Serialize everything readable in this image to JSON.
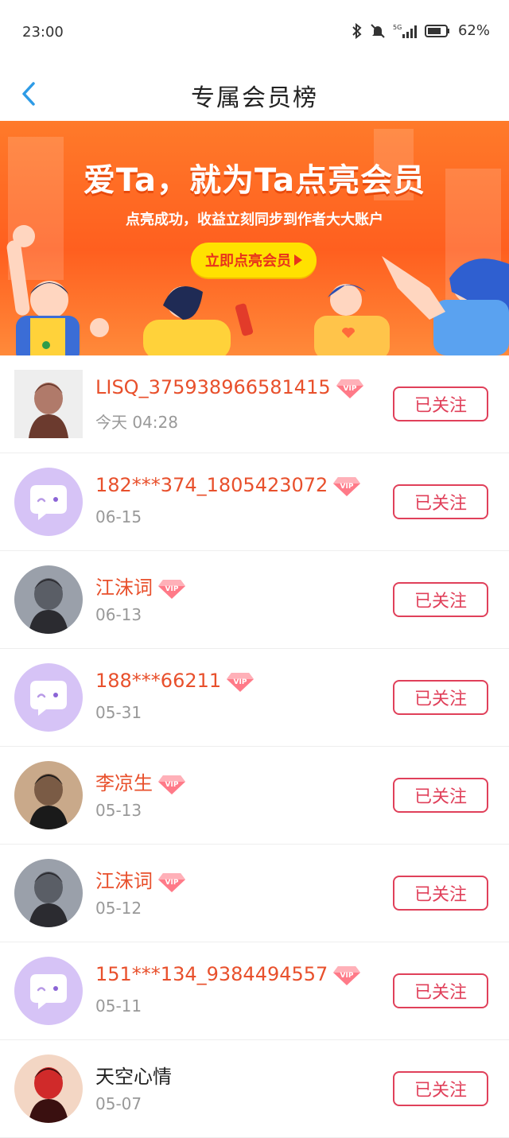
{
  "status_bar": {
    "time": "23:00",
    "icons": [
      "bluetooth-icon",
      "mute-icon",
      "5g-signal-icon",
      "battery-icon"
    ],
    "battery": "62%"
  },
  "header": {
    "title": "专属会员榜"
  },
  "banner": {
    "title": "爱Ta，就为Ta点亮会员",
    "subtitle": "点亮成功，收益立刻同步到作者大大账户",
    "button_label": "立即点亮会员"
  },
  "colors": {
    "accent": "#e8502c",
    "button_border": "#e0405a",
    "banner_btn": "#ffe100",
    "default_avatar": "#d6c3f6"
  },
  "members": [
    {
      "name": "LISQ_375938966581415",
      "date": "今天 04:28",
      "vip": true,
      "avatar": "photo-avatar-clothes",
      "button": "已关注"
    },
    {
      "name": "182***374_1805423072",
      "date": "06-15",
      "vip": true,
      "avatar": "default-avatar",
      "button": "已关注"
    },
    {
      "name": "江沫词",
      "date": "06-13",
      "vip": true,
      "avatar": "photo-avatar-dark",
      "button": "已关注"
    },
    {
      "name": "188***66211",
      "date": "05-31",
      "vip": true,
      "avatar": "default-avatar",
      "button": "已关注"
    },
    {
      "name": "李凉生",
      "date": "05-13",
      "vip": true,
      "avatar": "photo-avatar-man",
      "button": "已关注"
    },
    {
      "name": "江沫词",
      "date": "05-12",
      "vip": true,
      "avatar": "photo-avatar-dark",
      "button": "已关注"
    },
    {
      "name": "151***134_9384494557",
      "date": "05-11",
      "vip": true,
      "avatar": "default-avatar",
      "button": "已关注"
    },
    {
      "name": "天空心情",
      "date": "05-07",
      "vip": false,
      "avatar": "photo-avatar-child",
      "button": "已关注"
    }
  ]
}
